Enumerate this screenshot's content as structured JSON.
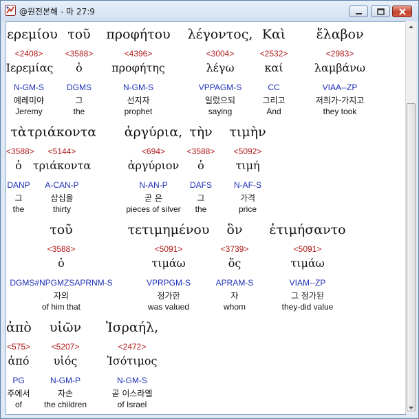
{
  "window": {
    "title": "@원전본해 - 마 27:9"
  },
  "colors": {
    "strong": "#b01818",
    "parse": "#1c2fb8",
    "text": "#111111"
  },
  "words": [
    {
      "greek": "Ἰερεμίου",
      "strong": "<2408>",
      "lemma": "Ἰερεμίας",
      "parse": "N-GM-S",
      "korean": "예레미야",
      "english": "Jeremy"
    },
    {
      "greek": "τοῦ",
      "strong": "<3588>",
      "lemma": "ὁ",
      "parse": "DGMS",
      "korean": "그",
      "english": "the"
    },
    {
      "greek": "προφήτου",
      "strong": "<4396>",
      "lemma": "προφήτης",
      "parse": "N-GM-S",
      "korean": "선지자",
      "english": "prophet"
    },
    {
      "greek": "λέγοντος,",
      "strong": "<3004>",
      "lemma": "λέγω",
      "parse": "VPPAGM-S",
      "korean": "일렀으되",
      "english": "saying"
    },
    {
      "greek": "Καὶ",
      "strong": "<2532>",
      "lemma": "καί",
      "parse": "CC",
      "korean": "그리고",
      "english": "And"
    },
    {
      "greek": "ἔλαβον",
      "strong": "<2983>",
      "lemma": "λαμβάνω",
      "parse": "VIAA--ZP",
      "korean": "저희가-가지고",
      "english": "they took"
    },
    {
      "greek": "τὰ",
      "strong": "<3588>",
      "lemma": "ὁ",
      "parse": "DANP",
      "korean": "그",
      "english": "the"
    },
    {
      "greek": "τριάκοντα",
      "strong": "<5144>",
      "lemma": "τριάκοντα",
      "parse": "A-CAN-P",
      "korean": "삼십을",
      "english": "thirty"
    },
    {
      "greek": "ἀργύρια,",
      "strong": "<694>",
      "lemma": "ἀργύριον",
      "parse": "N-AN-P",
      "korean": "곧 은",
      "english": "pieces of silver"
    },
    {
      "greek": "τὴν",
      "strong": "<3588>",
      "lemma": "ὁ",
      "parse": "DAFS",
      "korean": "그",
      "english": "the"
    },
    {
      "greek": "τιμὴν",
      "strong": "<5092>",
      "lemma": "τιμή",
      "parse": "N-AF-S",
      "korean": "가격",
      "english": "price"
    },
    {
      "greek": "τοῦ",
      "strong": "<3588>",
      "lemma": "ὁ",
      "parse": "DGMS#NPGMZSAPRNM-S",
      "korean": "자의",
      "english": "of him that"
    },
    {
      "greek": "τετιμημένου",
      "strong": "<5091>",
      "lemma": "τιμάω",
      "parse": "VPRPGM-S",
      "korean": "정가한",
      "english": "was valued"
    },
    {
      "greek": "ὃν",
      "strong": "<3739>",
      "lemma": "ὅς",
      "parse": "APRAM-S",
      "korean": "자",
      "english": "whom"
    },
    {
      "greek": "ἐτιμήσαντο",
      "strong": "<5091>",
      "lemma": "τιμάω",
      "parse": "VIAM--ZP",
      "korean": "그 정가된",
      "english": "they-did value"
    },
    {
      "greek": "ἀπὸ",
      "strong": "<575>",
      "lemma": "ἀπό",
      "parse": "PG",
      "korean": "주에서",
      "english": "of"
    },
    {
      "greek": "υἱῶν",
      "strong": "<5207>",
      "lemma": "υἱός",
      "parse": "N-GM-P",
      "korean": "자손",
      "english": "the children"
    },
    {
      "greek": "Ἰσραήλ,",
      "strong": "<2472>",
      "lemma": "Ἰσότιμος",
      "parse": "N-GM-S",
      "korean": "곧 이스라엘",
      "english": "of Israel"
    }
  ]
}
